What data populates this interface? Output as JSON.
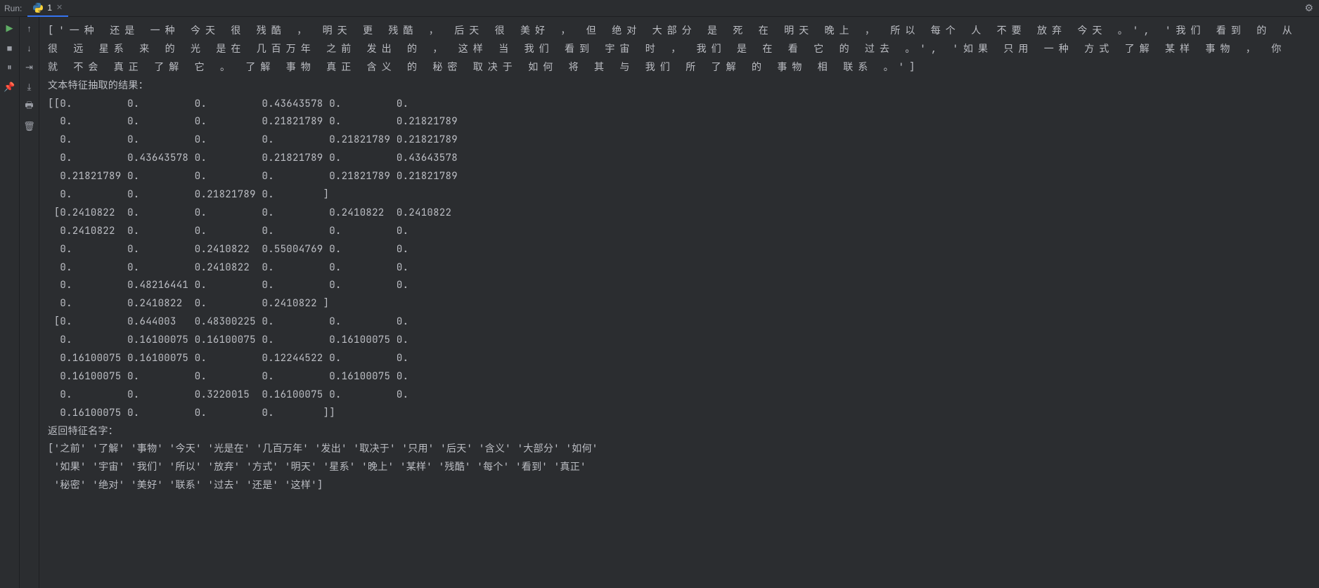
{
  "top_bar": {
    "run_label": "Run:",
    "tab_label": "1"
  },
  "console": {
    "text_list": "['一种 还是 一种 今天 很 残酷 ， 明天 更 残酷 ， 后天 很 美好 ， 但 绝对 大部分 是 死 在 明天 晚上 ， 所以 每个 人 不要 放弃 今天 。', '我们 看到 的 从 很 远 星系 来 的 光 是在 几百万年 之前 发出 的 ， 这样 当 我们 看到 宇宙 时 ， 我们 是 在 看 它 的 过去 。', '如果 只用 一种 方式 了解 某样 事物 ， 你 就 不会 真正 了解 它 。 了解 事物 真正 含义 的 秘密 取决于 如何 将 其 与 我们 所 了解 的 事物 相 联系 。']",
    "feature_header": "文本特征抽取的结果：",
    "matrix_lines": [
      "[[0.         0.         0.         0.43643578 0.         0.",
      "  0.         0.         0.         0.21821789 0.         0.21821789",
      "  0.         0.         0.         0.         0.21821789 0.21821789",
      "  0.         0.43643578 0.         0.21821789 0.         0.43643578",
      "  0.21821789 0.         0.         0.         0.21821789 0.21821789",
      "  0.         0.         0.21821789 0.        ]",
      " [0.2410822  0.         0.         0.         0.2410822  0.2410822",
      "  0.2410822  0.         0.         0.         0.         0.",
      "  0.         0.         0.2410822  0.55004769 0.         0.",
      "  0.         0.         0.2410822  0.         0.         0.",
      "  0.         0.48216441 0.         0.         0.         0.",
      "  0.         0.2410822  0.         0.2410822 ]",
      " [0.         0.644003   0.48300225 0.         0.         0.",
      "  0.         0.16100075 0.16100075 0.         0.16100075 0.",
      "  0.16100075 0.16100075 0.         0.12244522 0.         0.",
      "  0.16100075 0.         0.         0.         0.16100075 0.",
      "  0.         0.         0.3220015  0.16100075 0.         0.",
      "  0.16100075 0.         0.         0.        ]]"
    ],
    "names_header": "返回特征名字：",
    "names_lines": [
      "['之前' '了解' '事物' '今天' '光是在' '几百万年' '发出' '取决于' '只用' '后天' '含义' '大部分' '如何'",
      " '如果' '宇宙' '我们' '所以' '放弃' '方式' '明天' '星系' '晚上' '某样' '残酷' '每个' '看到' '真正'",
      " '秘密' '绝对' '美好' '联系' '过去' '还是' '这样']"
    ]
  }
}
